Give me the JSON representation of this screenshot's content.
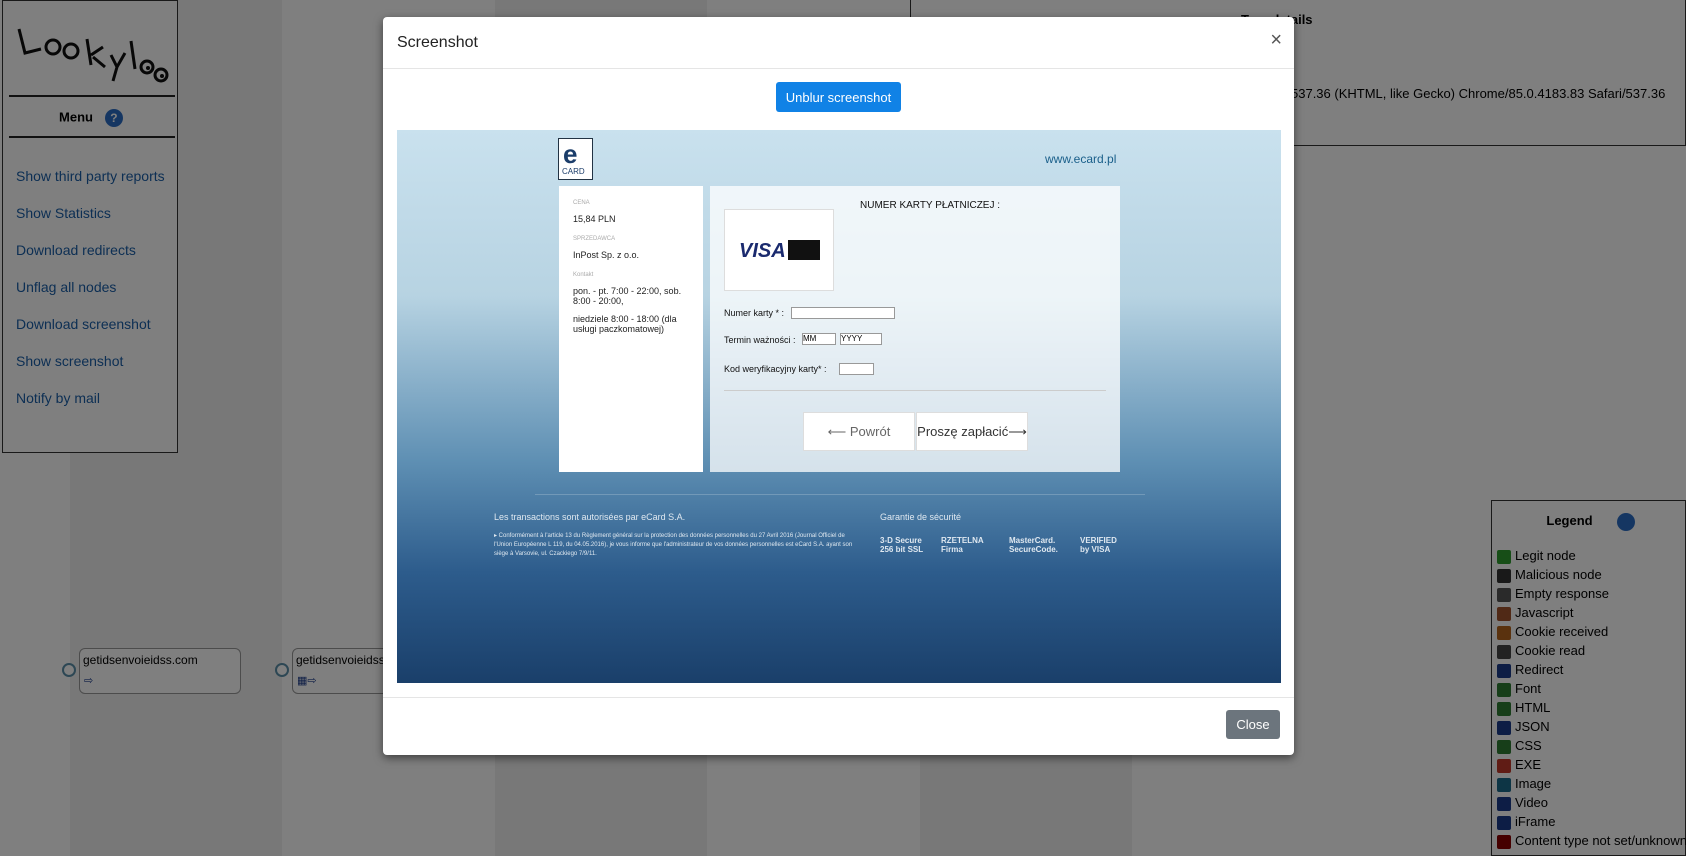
{
  "menu": {
    "title": "Menu",
    "links": [
      "Show third party reports",
      "Show Statistics",
      "Download redirects",
      "Unflag all nodes",
      "Download screenshot",
      "Show screenshot",
      "Notify by mail"
    ]
  },
  "tree": {
    "title": "Tree details",
    "ua": "537.36 (KHTML, like Gecko) Chrome/85.0.4183.83 Safari/537.36"
  },
  "nodes": [
    "getidsenvoieidss.com",
    "getidsenvoieidss"
  ],
  "legend": {
    "title": "Legend",
    "items": [
      {
        "label": "Legit node",
        "color": "#2e9d2e"
      },
      {
        "label": "Malicious node",
        "color": "#333333"
      },
      {
        "label": "Empty response",
        "color": "#555555"
      },
      {
        "label": "Javascript",
        "color": "#a0522d"
      },
      {
        "label": "Cookie received",
        "color": "#b5651d"
      },
      {
        "label": "Cookie read",
        "color": "#444444"
      },
      {
        "label": "Redirect",
        "color": "#1a3a8a"
      },
      {
        "label": "Font",
        "color": "#2e7d32"
      },
      {
        "label": "HTML",
        "color": "#2e7d32"
      },
      {
        "label": "JSON",
        "color": "#1a3a8a"
      },
      {
        "label": "CSS",
        "color": "#2e7d32"
      },
      {
        "label": "EXE",
        "color": "#c0392b"
      },
      {
        "label": "Image",
        "color": "#1a6a8a"
      },
      {
        "label": "Video",
        "color": "#1a3a8a"
      },
      {
        "label": "iFrame",
        "color": "#1a3a8a"
      },
      {
        "label": "Content type not set/unknown",
        "color": "#8b0000"
      }
    ]
  },
  "modal": {
    "title": "Screenshot",
    "close_x": "×",
    "unblur": "Unblur screenshot",
    "close": "Close"
  },
  "shot": {
    "url": "www.ecard.pl",
    "logo_e": "e",
    "logo_card": "CARD",
    "price_label": "CENA",
    "price": "15,84 PLN",
    "seller_label": "SPRZEDAWCA",
    "seller": "InPost Sp. z o.o.",
    "contact_label": "Kontakt",
    "hours1": "pon. - pt. 7:00 - 22:00, sob. 8:00 - 20:00,",
    "hours2": "niedziele 8:00 - 18:00 (dla usługi paczkomatowej)",
    "card_title": "NUMER KARTY PŁATNICZEJ :",
    "card_no_label": "Numer karty * :",
    "expiry_label": "Termin ważności :",
    "mm": "MM",
    "yyyy": "YYYY",
    "cvv_label": "Kod weryfikacyjny karty* :",
    "back": "⟵ Powrót",
    "pay": "Proszę zapłacić⟶",
    "footer_title": "Les transactions sont autorisées par eCard S.A.",
    "footer_text": "▸ Conformément à l'article 13 du Règlement général sur la protection des données personnelles du 27 Avril 2016 (Journal Officiel de l'Union Européenne L 119, du 04.05.2016), je vous informe que l'administrateur de vos données personnelles est eCard S.A. ayant son siège à Varsovie, ul. Czackiego 7/9/11.",
    "security_title": "Garantie de sécurité",
    "sec1": "3-D Secure 256 bit SSL",
    "sec2": "RZETELNA Firma",
    "sec3": "MasterCard. SecureCode.",
    "sec4": "VERIFIED by VISA",
    "visa": "VISA"
  }
}
